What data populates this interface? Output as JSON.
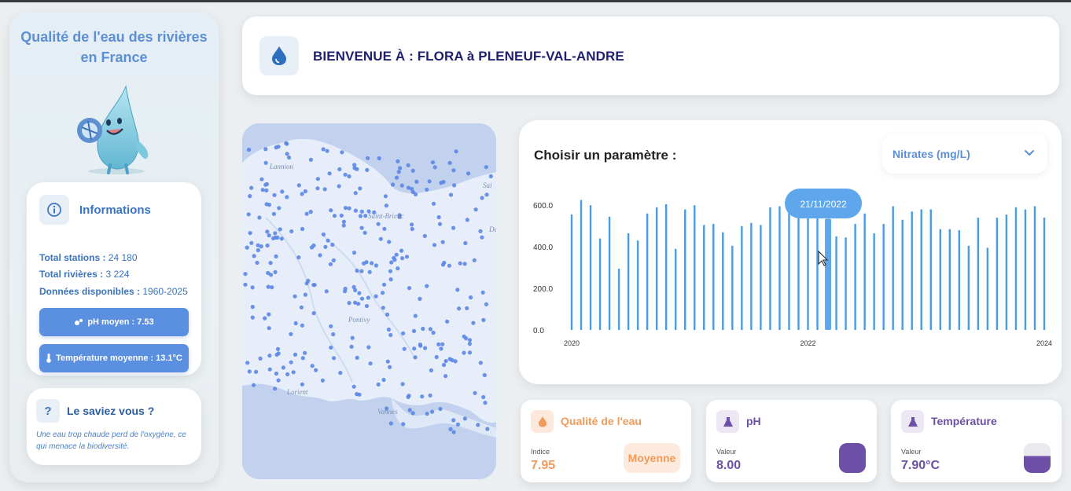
{
  "sidebar": {
    "title_line1": "Qualité de l'eau des rivières",
    "title_line2": "en France",
    "info": {
      "title": "Informations",
      "lines": [
        {
          "label": "Total stations :",
          "value": " 24 180"
        },
        {
          "label": "Total rivières :",
          "value": " 3 224"
        },
        {
          "label": "Données disponibles :",
          "value": " 1960-2025"
        }
      ],
      "ph_button": "pH moyen : 7.53",
      "temp_button": "Température moyenne : 13.1°C"
    },
    "fact": {
      "icon_label": "?",
      "title": "Le saviez vous ?",
      "text": "Une eau trop chaude perd de l'oxygène, ce qui menace la biodiversité."
    }
  },
  "header": {
    "title": "BIENVENUE À : FLORA à PLENEUF-VAL-ANDRE"
  },
  "map": {
    "labels": [
      "Lannion",
      "Saint-Brieuc",
      "Pontivy",
      "Lorient",
      "Vannes",
      "Sai",
      "Dé"
    ]
  },
  "chart_panel": {
    "title": "Choisir un paramètre :",
    "selected_parameter": "Nitrates (mg/L)",
    "tooltip": "21/11/2022"
  },
  "chart_data": {
    "type": "bar",
    "x_start": 2020.0,
    "x_end": 2024.0,
    "x_ticks": [
      "2020",
      "2022",
      "2024"
    ],
    "y_ticks": [
      "0.0",
      "200.0",
      "400.0",
      "600.0"
    ],
    "ylim": [
      0,
      650
    ],
    "highlighted_date": "21/11/2022",
    "bars": [
      {
        "x": 2020.0,
        "y": 555
      },
      {
        "x": 2020.08,
        "y": 625
      },
      {
        "x": 2020.16,
        "y": 600
      },
      {
        "x": 2020.24,
        "y": 440
      },
      {
        "x": 2020.32,
        "y": 545
      },
      {
        "x": 2020.4,
        "y": 295
      },
      {
        "x": 2020.48,
        "y": 465
      },
      {
        "x": 2020.56,
        "y": 430
      },
      {
        "x": 2020.64,
        "y": 560
      },
      {
        "x": 2020.72,
        "y": 590
      },
      {
        "x": 2020.8,
        "y": 605
      },
      {
        "x": 2020.88,
        "y": 390
      },
      {
        "x": 2020.96,
        "y": 580
      },
      {
        "x": 2021.04,
        "y": 600
      },
      {
        "x": 2021.12,
        "y": 505
      },
      {
        "x": 2021.2,
        "y": 510
      },
      {
        "x": 2021.28,
        "y": 470
      },
      {
        "x": 2021.36,
        "y": 405
      },
      {
        "x": 2021.44,
        "y": 500
      },
      {
        "x": 2021.52,
        "y": 515
      },
      {
        "x": 2021.6,
        "y": 505
      },
      {
        "x": 2021.68,
        "y": 590
      },
      {
        "x": 2021.76,
        "y": 595
      },
      {
        "x": 2021.84,
        "y": 595
      },
      {
        "x": 2021.92,
        "y": 640
      },
      {
        "x": 2022.0,
        "y": 650
      },
      {
        "x": 2022.08,
        "y": 570
      },
      {
        "x": 2022.17,
        "y": 535
      },
      {
        "x": 2022.24,
        "y": 450
      },
      {
        "x": 2022.32,
        "y": 445
      },
      {
        "x": 2022.4,
        "y": 510
      },
      {
        "x": 2022.48,
        "y": 560
      },
      {
        "x": 2022.56,
        "y": 465
      },
      {
        "x": 2022.64,
        "y": 510
      },
      {
        "x": 2022.72,
        "y": 595
      },
      {
        "x": 2022.8,
        "y": 530
      },
      {
        "x": 2022.88,
        "y": 570
      },
      {
        "x": 2022.96,
        "y": 580
      },
      {
        "x": 2023.04,
        "y": 580
      },
      {
        "x": 2023.12,
        "y": 485
      },
      {
        "x": 2023.2,
        "y": 485
      },
      {
        "x": 2023.28,
        "y": 480
      },
      {
        "x": 2023.36,
        "y": 405
      },
      {
        "x": 2023.44,
        "y": 540
      },
      {
        "x": 2023.52,
        "y": 395
      },
      {
        "x": 2023.6,
        "y": 540
      },
      {
        "x": 2023.68,
        "y": 555
      },
      {
        "x": 2023.76,
        "y": 590
      },
      {
        "x": 2023.84,
        "y": 580
      },
      {
        "x": 2023.92,
        "y": 595
      },
      {
        "x": 2024.0,
        "y": 540
      }
    ]
  },
  "cards": {
    "quality": {
      "title": "Qualité de l'eau",
      "sub": "Indice",
      "value": "7.95",
      "badge": "Moyenne",
      "color": "#f09a5c"
    },
    "ph": {
      "title": "pH",
      "sub": "Valeur",
      "value": "8.00",
      "color": "#6c4fa6"
    },
    "temp": {
      "title": "Température",
      "sub": "Valeur",
      "value": "7.90°C",
      "color": "#6c4fa6"
    }
  },
  "colors": {
    "accent": "#5b8fe0",
    "bar": "#4a9be3",
    "title_blue": "#5b8fd6",
    "header_navy": "#1e1f6e"
  }
}
